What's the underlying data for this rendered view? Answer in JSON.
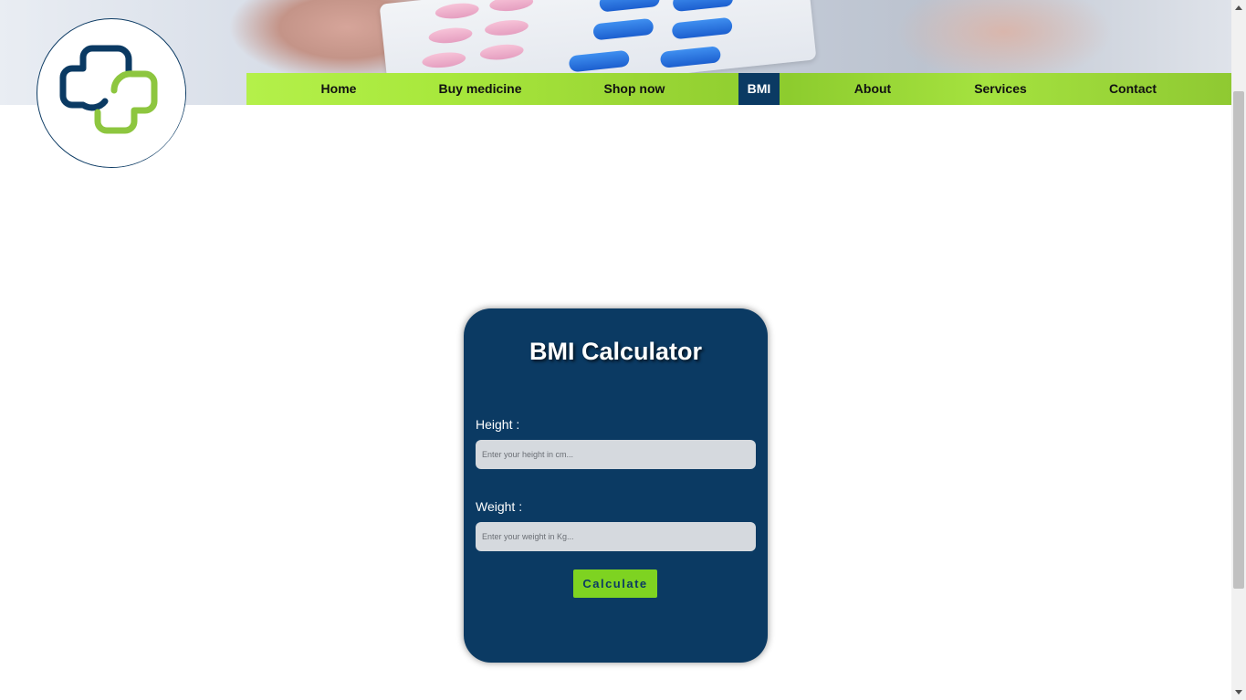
{
  "nav": {
    "items": [
      {
        "label": "Home"
      },
      {
        "label": "Buy medicine"
      },
      {
        "label": "Shop now"
      },
      {
        "label": "BMI"
      },
      {
        "label": "About"
      },
      {
        "label": "Services"
      },
      {
        "label": "Contact"
      }
    ],
    "active_label": "BMI"
  },
  "bmi": {
    "title": "BMI Calculator",
    "height_label": "Height :",
    "height_placeholder": "Enter your height in cm...",
    "weight_label": "Weight :",
    "weight_placeholder": "Enter your weight in Kg...",
    "calculate_label": "Calculate"
  },
  "colors": {
    "brand_navy": "#0b3a63",
    "nav_green": "#a8e83c",
    "button_green": "#7ed321",
    "logo_green": "#8dc63f"
  },
  "icons": {
    "logo": "medical-cross-logo-icon",
    "scroll_up": "arrow-up-icon",
    "scroll_down": "arrow-down-icon"
  }
}
